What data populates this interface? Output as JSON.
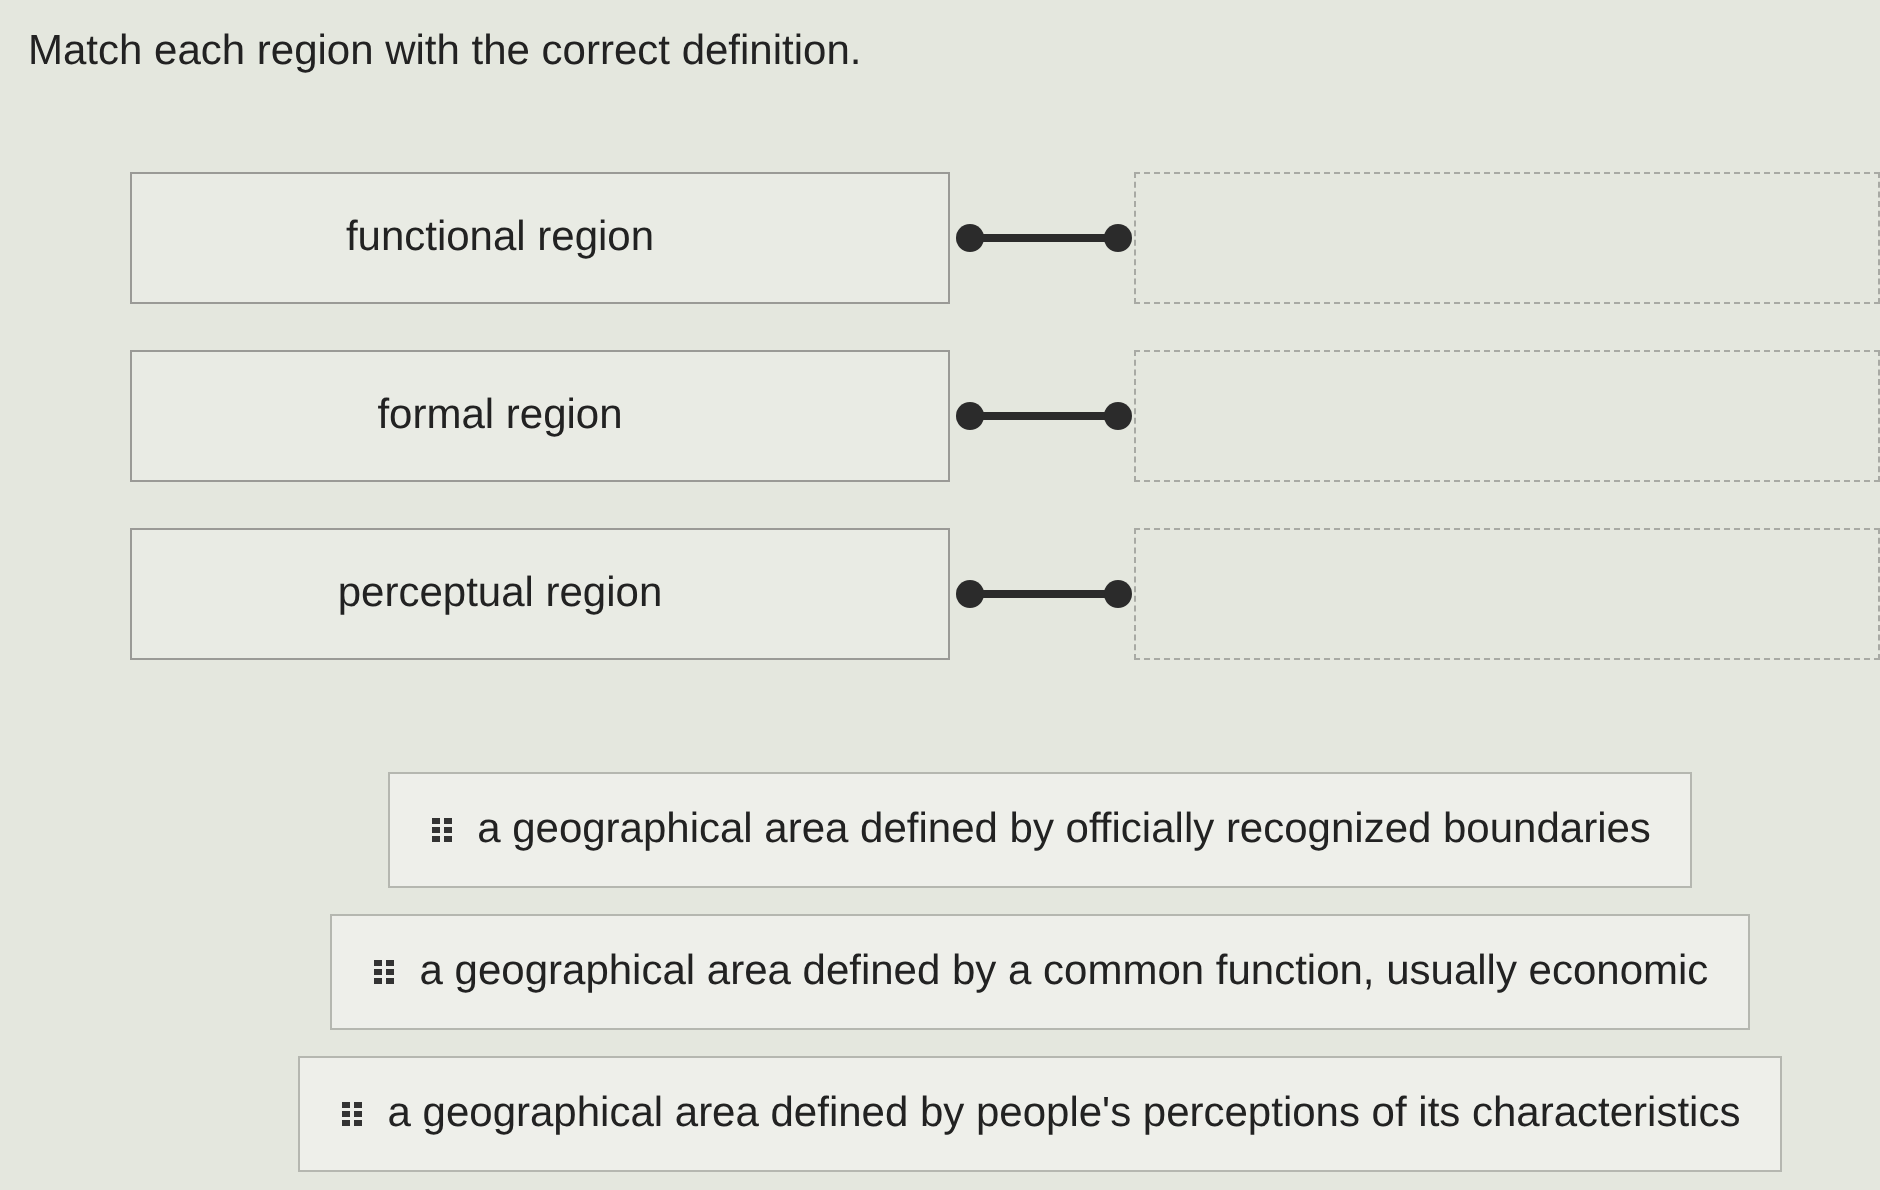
{
  "prompt": "Match each region with the correct definition.",
  "terms": [
    {
      "label": "functional region"
    },
    {
      "label": "formal region"
    },
    {
      "label": "perceptual region"
    }
  ],
  "answers": [
    {
      "text": "a geographical area defined by officially recognized boundaries"
    },
    {
      "text": "a geographical area defined by a common function, usually economic"
    },
    {
      "text": "a geographical area defined by people's perceptions of its characteristics"
    }
  ]
}
